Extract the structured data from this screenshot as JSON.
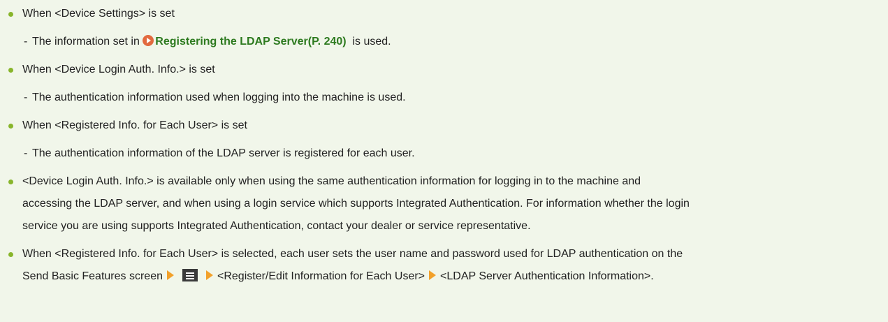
{
  "items": [
    {
      "text": "When <Device Settings> is set",
      "sub": {
        "prefix": "The information set in ",
        "link": "Registering the LDAP Server(P. 240)",
        "suffix": "  is used."
      }
    },
    {
      "text": "When <Device Login Auth. Info.> is set",
      "sub": {
        "text": "The authentication information used when logging into the machine is used."
      }
    },
    {
      "text": "When <Registered Info. for Each User> is set",
      "sub": {
        "text": "The authentication information of the LDAP server is registered for each user."
      }
    }
  ],
  "note1": {
    "line1": "<Device Login Auth. Info.> is available only when using the same authentication information for logging in to the machine and",
    "line2": "accessing the LDAP server, and when using a login service which supports Integrated Authentication. For information whether the login",
    "line3": "service you are using supports Integrated Authentication, contact your dealer or service representative."
  },
  "note2": {
    "line1": "When <Registered Info. for Each User> is selected, each user sets the user name and password used for LDAP authentication on the",
    "line2_a": "Send Basic Features screen",
    "line2_b": "<Register/Edit Information for Each User>",
    "line2_c": "<LDAP Server Authentication Information>."
  },
  "colors": {
    "background": "#f1f6ea",
    "bullet": "#88b52b",
    "link": "#2d7a1f",
    "link_icon": "#e26a3f",
    "arrow_icon": "#f2a12b"
  },
  "icons": {
    "link_icon": "circle-arrow-icon",
    "step_arrow": "right-arrow-icon",
    "menu": "menu-icon"
  }
}
